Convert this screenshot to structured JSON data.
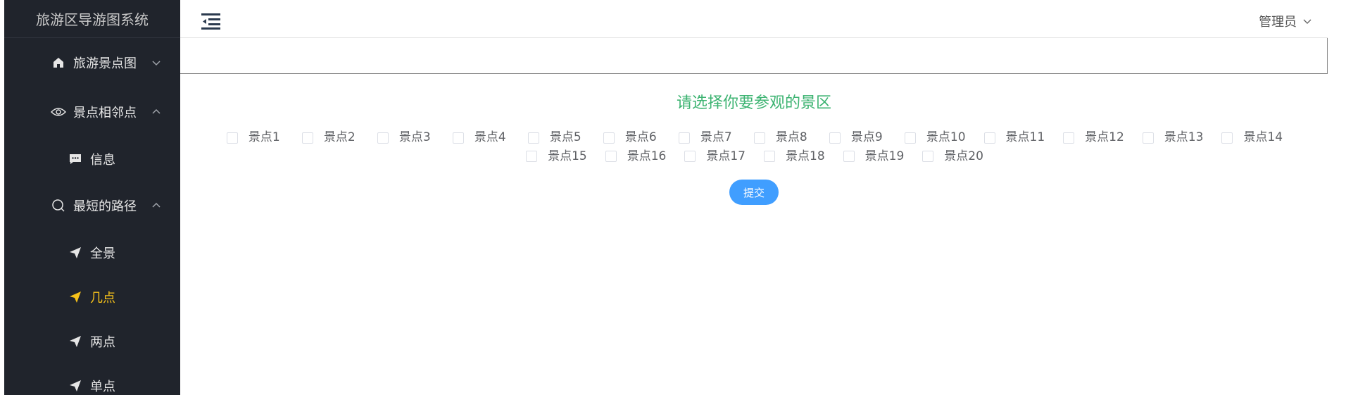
{
  "app": {
    "title": "旅游区导游图系统"
  },
  "sidebar": {
    "items": [
      {
        "label": "旅游景点图",
        "icon": "home-icon",
        "chevron": "down"
      },
      {
        "label": "景点相邻点",
        "icon": "eye-icon",
        "chevron": "up",
        "children": [
          {
            "label": "信息",
            "icon": "message-icon"
          }
        ]
      },
      {
        "label": "最短的路径",
        "icon": "search-icon",
        "chevron": "up",
        "children": [
          {
            "label": "全景",
            "icon": "send-icon"
          },
          {
            "label": "几点",
            "icon": "send-icon",
            "active": true
          },
          {
            "label": "两点",
            "icon": "send-icon"
          },
          {
            "label": "单点",
            "icon": "send-icon"
          }
        ]
      }
    ]
  },
  "header": {
    "user_label": "管理员"
  },
  "main": {
    "title": "请选择你要参观的景区",
    "options": [
      "景点1",
      "景点2",
      "景点3",
      "景点4",
      "景点5",
      "景点6",
      "景点7",
      "景点8",
      "景点9",
      "景点10",
      "景点11",
      "景点12",
      "景点13",
      "景点14",
      "景点15",
      "景点16",
      "景点17",
      "景点18",
      "景点19",
      "景点20"
    ],
    "submit_label": "提交"
  },
  "colors": {
    "sidebar_bg": "#20242c",
    "active_menu": "#f5c11a",
    "title_green": "#3cb371",
    "primary": "#409eff"
  }
}
